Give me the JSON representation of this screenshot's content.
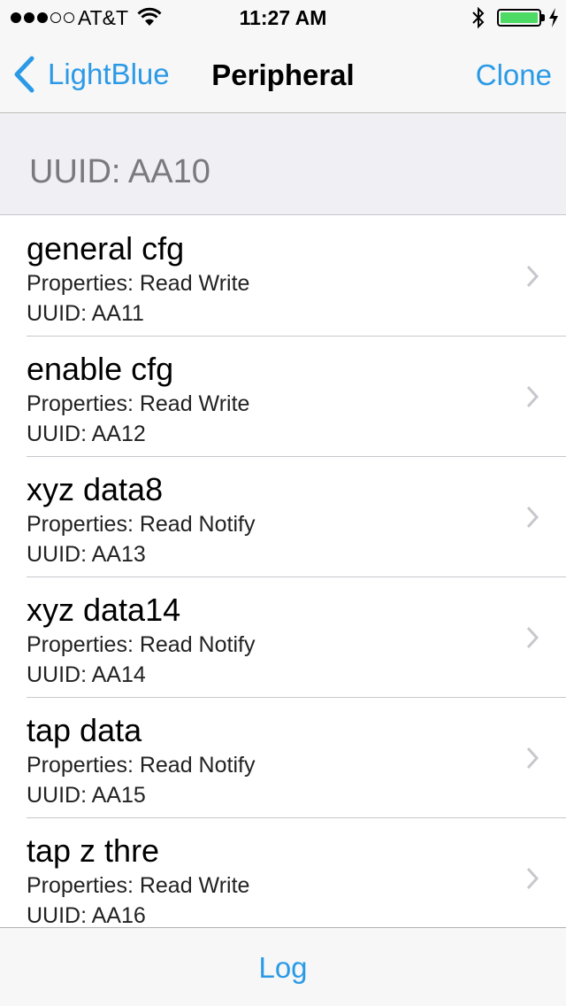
{
  "status_bar": {
    "carrier": "AT&T",
    "time": "11:27 AM",
    "signal_bars_filled": 3,
    "signal_bars_total": 5,
    "battery_level": 1.0,
    "battery_color": "#4cd964"
  },
  "nav": {
    "back_label": "LightBlue",
    "title": "Peripheral",
    "action_label": "Clone",
    "tint_color": "#2b9ae6"
  },
  "service": {
    "header": "UUID: AA10"
  },
  "characteristics": [
    {
      "name": "general cfg",
      "properties": "Properties: Read Write",
      "uuid": "UUID: AA11"
    },
    {
      "name": "enable cfg",
      "properties": "Properties: Read Write",
      "uuid": "UUID: AA12"
    },
    {
      "name": "xyz data8",
      "properties": "Properties: Read Notify",
      "uuid": "UUID: AA13"
    },
    {
      "name": "xyz data14",
      "properties": "Properties: Read Notify",
      "uuid": "UUID: AA14"
    },
    {
      "name": "tap data",
      "properties": "Properties: Read Notify",
      "uuid": "UUID: AA15"
    },
    {
      "name": "tap z thre",
      "properties": "Properties: Read Write",
      "uuid": "UUID: AA16"
    }
  ],
  "toolbar": {
    "log_label": "Log"
  },
  "icons": {
    "back": "chevron-left-icon",
    "row_disclosure": "chevron-right-icon",
    "wifi": "wifi-icon",
    "bluetooth": "bluetooth-icon",
    "battery": "battery-icon",
    "charging": "charging-bolt-icon"
  }
}
